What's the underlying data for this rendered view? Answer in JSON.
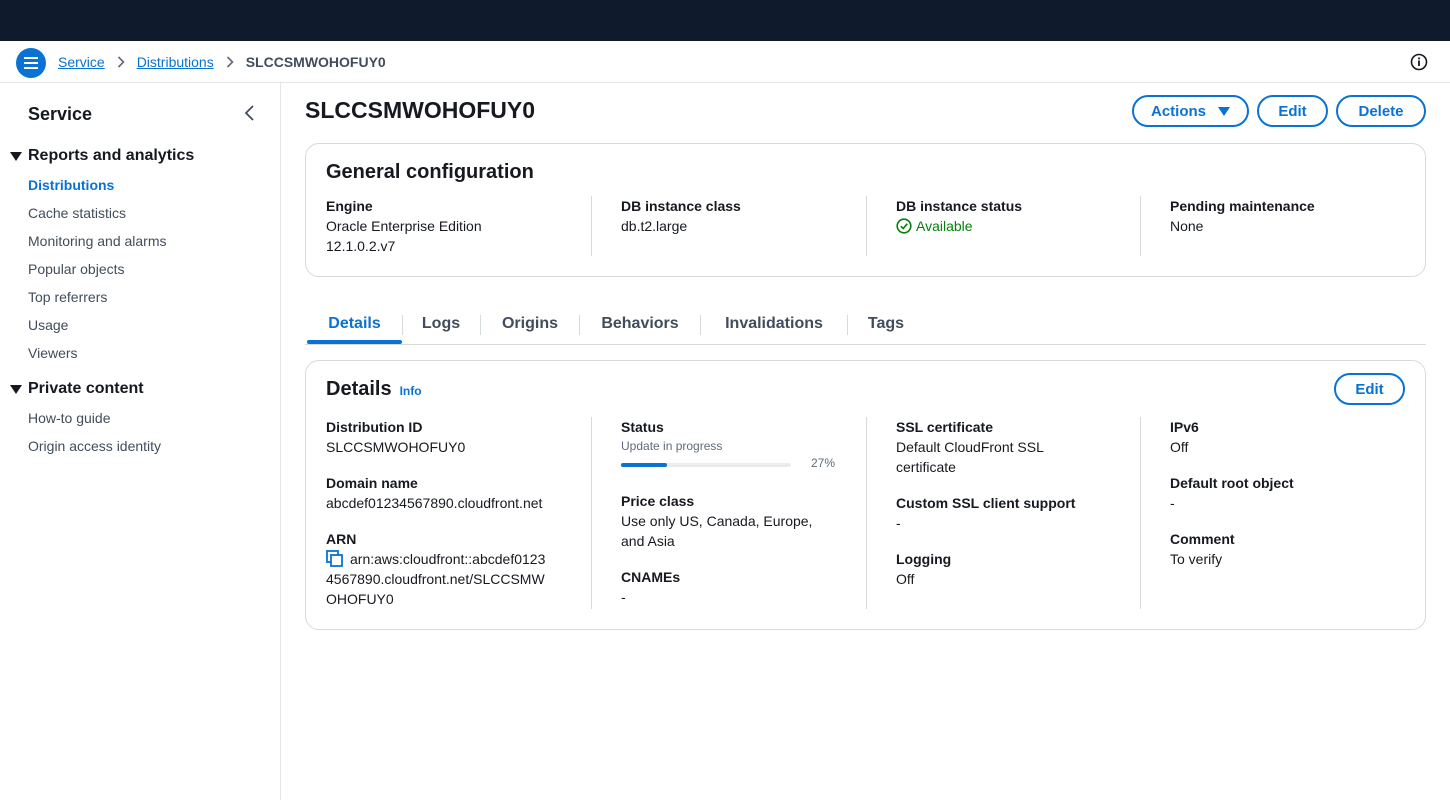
{
  "colors": {
    "topbar": "#0f1b2d",
    "accent": "#0972d3",
    "success": "#037f0c"
  },
  "breadcrumb": {
    "items": [
      "Service",
      "Distributions"
    ],
    "current": "SLCCSMWOHOFUY0"
  },
  "sidebar": {
    "title": "Service",
    "sections": [
      {
        "label": "Reports and analytics",
        "items": [
          "Distributions",
          "Cache statistics",
          "Monitoring and alarms",
          "Popular objects",
          "Top referrers",
          "Usage",
          "Viewers"
        ]
      },
      {
        "label": "Private content",
        "items": [
          "How-to guide",
          "Origin access identity"
        ]
      }
    ],
    "active_item": "Distributions"
  },
  "page": {
    "title": "SLCCSMWOHOFUY0",
    "actions_label": "Actions",
    "edit_label": "Edit",
    "delete_label": "Delete"
  },
  "general": {
    "title": "General configuration",
    "engine_label": "Engine",
    "engine_value_line1": "Oracle Enterprise Edition",
    "engine_value_line2": "12.1.0.2.v7",
    "class_label": "DB instance class",
    "class_value": "db.t2.large",
    "status_label": "DB instance status",
    "status_value": "Available",
    "maint_label": "Pending maintenance",
    "maint_value": "None"
  },
  "tabs": [
    "Details",
    "Logs",
    "Origins",
    "Behaviors",
    "Invalidations",
    "Tags"
  ],
  "details": {
    "title": "Details",
    "info_label": "Info",
    "edit_label": "Edit",
    "dist_id_label": "Distribution ID",
    "dist_id_value": "SLCCSMWOHOFUY0",
    "domain_label": "Domain name",
    "domain_value": "abcdef01234567890.cloudfront.net",
    "arn_label": "ARN",
    "arn_line1": "arn:aws:cloudfront::abcdef0123",
    "arn_line2": "4567890.cloudfront.net/SLCCSMW",
    "arn_line3": "OHOFUY0",
    "status_label": "Status",
    "status_value": "Update in progress",
    "progress_percent": 27,
    "progress_text": "27%",
    "price_label": "Price class",
    "price_line1": "Use only US, Canada, Europe,",
    "price_line2": "and Asia",
    "cnames_label": "CNAMEs",
    "cnames_value": "-",
    "ssl_label": "SSL certificate",
    "ssl_line1": "Default CloudFront SSL",
    "ssl_line2": "certificate",
    "custom_ssl_label": "Custom SSL client support",
    "custom_ssl_value": "-",
    "logging_label": "Logging",
    "logging_value": "Off",
    "ipv6_label": "IPv6",
    "ipv6_value": "Off",
    "root_label": "Default root object",
    "root_value": "-",
    "comment_label": "Comment",
    "comment_value": "To verify"
  }
}
